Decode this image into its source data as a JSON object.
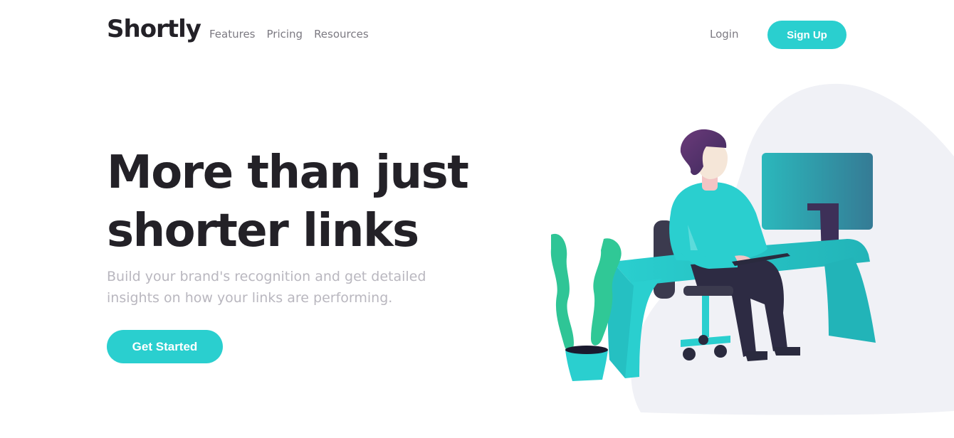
{
  "header": {
    "logo": "Shortly",
    "nav": [
      "Features",
      "Pricing",
      "Resources"
    ],
    "login_label": "Login",
    "signup_label": "Sign Up"
  },
  "hero": {
    "title_line1": "More than just",
    "title_line2": "shorter links",
    "subtitle_line1": "Build your brand's recognition and get detailed",
    "subtitle_line2": "insights on how your links are performing.",
    "cta_label": "Get Started"
  },
  "colors": {
    "accent": "#2acfcf",
    "heading": "#232127",
    "muted": "#b9b7bf",
    "blob": "#f0f1f6",
    "plant": "#2fc596"
  },
  "illustration": {
    "icon": "person-working-at-desk-illustration"
  }
}
